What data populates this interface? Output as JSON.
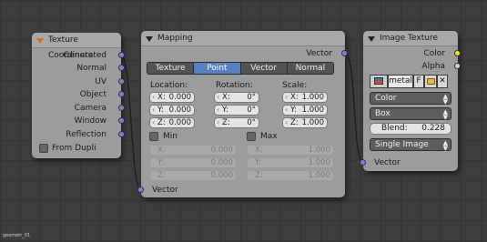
{
  "texcoord": {
    "title": "Texture Coordinate",
    "outputs": [
      "Generated",
      "Normal",
      "UV",
      "Object",
      "Camera",
      "Window",
      "Reflection"
    ],
    "from_dupli": "From Dupli"
  },
  "mapping": {
    "title": "Mapping",
    "output": "Vector",
    "tabs": [
      "Texture",
      "Point",
      "Vector",
      "Normal"
    ],
    "active_tab": "Point",
    "location": {
      "label": "Location:",
      "x": "0.000",
      "y": "0.000",
      "z": "0.000"
    },
    "rotation": {
      "label": "Rotation:",
      "x": "0°",
      "y": "0°",
      "z": "0°"
    },
    "scale": {
      "label": "Scale:",
      "x": "1.000",
      "y": "1.000",
      "z": "1.000"
    },
    "min": {
      "label": "Min",
      "x": "0.000",
      "y": "0.000",
      "z": "0.000"
    },
    "max": {
      "label": "Max",
      "x": "1.000",
      "y": "1.000",
      "z": "1.000"
    },
    "axis": {
      "x": "X:",
      "y": "Y:",
      "z": "Z:"
    },
    "input": "Vector"
  },
  "imagetex": {
    "title": "Image Texture",
    "outputs": [
      "Color",
      "Alpha"
    ],
    "image_name": "metal",
    "fake_user": "F",
    "color_space": "Color",
    "projection": "Box",
    "blend_label": "Blend:",
    "blend_value": "0.228",
    "extension": "Single Image",
    "input": "Vector"
  },
  "footer": "geometr_01",
  "colors": {
    "socket_vector": "#7e7ee0",
    "socket_color": "#f2e31e",
    "socket_float": "#d8d8d8",
    "active_tab": "#5680c2"
  }
}
